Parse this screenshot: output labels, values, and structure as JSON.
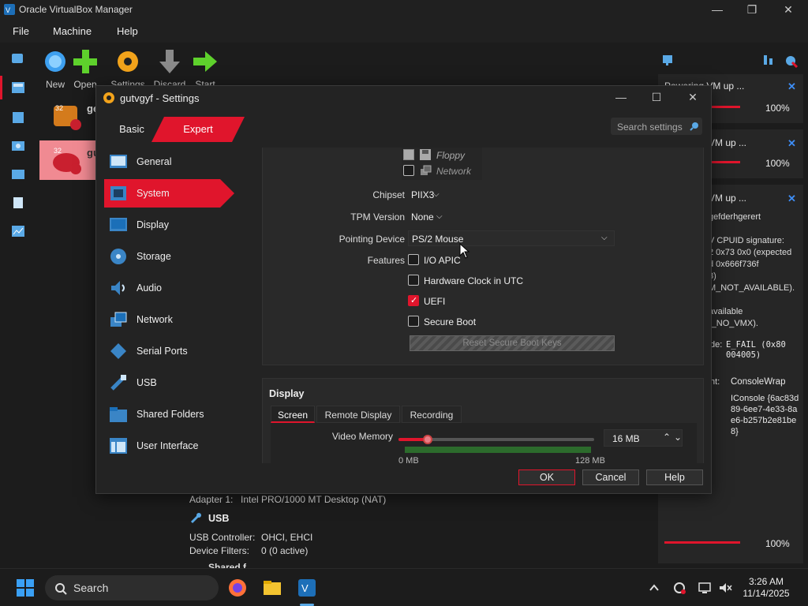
{
  "window": {
    "title": "Oracle VirtualBox Manager",
    "minimize": "—",
    "maximize": "❐",
    "close": "✕"
  },
  "menu": {
    "file": "File",
    "machine": "Machine",
    "help": "Help"
  },
  "toolbar": {
    "new": "New",
    "open": "Open",
    "settings": "Settings",
    "discard": "Discard",
    "start": "Start"
  },
  "vms": [
    {
      "name": "ge"
    },
    {
      "name": "gu"
    }
  ],
  "details": {
    "adapter_label": "Adapter 1:",
    "adapter_value": "Intel PRO/1000 MT Desktop (NAT)",
    "usb_header": "USB",
    "usb_controller_label": "USB Controller:",
    "usb_controller_value": "OHCI, EHCI",
    "device_filters_label": "Device Filters:",
    "device_filters_value": "0 (0 active)",
    "shared_header": "Shared f..."
  },
  "notifications": {
    "n1_title": "Powering VM up ...",
    "n1_pct": "100%",
    "n2_title": "VM up ...",
    "n2_pct": "100%",
    "n3_title": "VM up ...",
    "n3_lines": [
      "gefderhgerert",
      "",
      "V CPUID signature:",
      "2 0x73 0x0 (expected",
      "d 0x666f736f",
      "8)",
      "M_NOT_AVAILABLE).",
      "",
      "available",
      "(_NO_VMX)."
    ],
    "n3_code_label": "de:",
    "n3_code_value": "E_FAIL (0x80004005)",
    "n3_comp_label": "nt:",
    "n3_comp_value": "ConsoleWrap",
    "n3_iface_value": "IConsole {6ac83d89-6ee7-4e33-8ae6-b257b2e81be8}",
    "n4_pct": "100%"
  },
  "taskbar": {
    "search": "Search",
    "time": "3:26 AM",
    "date": "11/14/2025"
  },
  "dialog": {
    "title": "gutvgyf - Settings",
    "mode_basic": "Basic",
    "mode_expert": "Expert",
    "search_placeholder": "Search settings",
    "categories": [
      "General",
      "System",
      "Display",
      "Storage",
      "Audio",
      "Network",
      "Serial Ports",
      "USB",
      "Shared Folders",
      "User Interface"
    ],
    "boot_items": [
      "Floppy",
      "Network"
    ],
    "chipset_label": "Chipset",
    "chipset_value": "PIIX3",
    "tpm_label": "TPM Version",
    "tpm_value": "None",
    "pointing_label": "Pointing Device",
    "pointing_value": "PS/2 Mouse",
    "features_label": "Features",
    "features": [
      {
        "label": "I/O APIC",
        "checked": false
      },
      {
        "label": "Hardware Clock in UTC",
        "checked": false
      },
      {
        "label": "UEFI",
        "checked": true
      },
      {
        "label": "Secure Boot",
        "checked": false
      }
    ],
    "reset_keys_label": "Reset Secure Boot Keys",
    "display_header": "Display",
    "tabs": [
      "Screen",
      "Remote Display",
      "Recording"
    ],
    "video_memory_label": "Video Memory",
    "video_memory_value": "16 MB",
    "video_memory_fraction": 0.15,
    "slider_min": "0 MB",
    "slider_max": "128 MB",
    "ok": "OK",
    "cancel": "Cancel",
    "help": "Help"
  },
  "colors": {
    "accent": "#e0152c",
    "link": "#3e8ef7"
  }
}
